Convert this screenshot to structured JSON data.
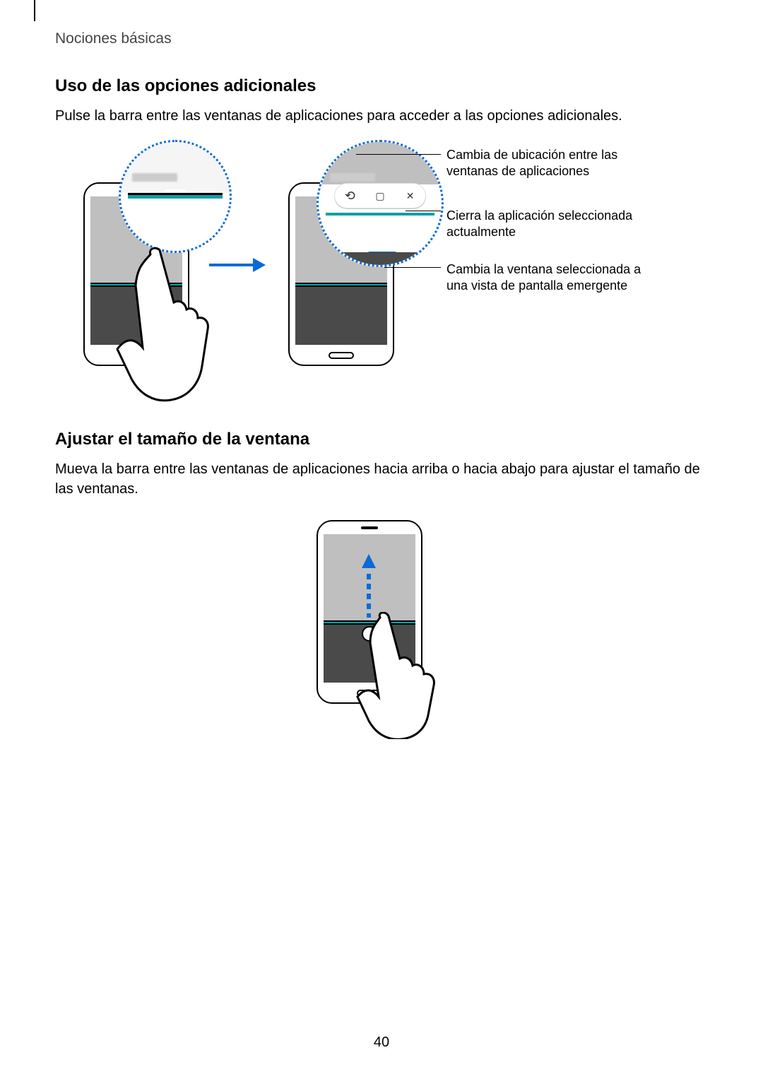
{
  "breadcrumb": "Nociones básicas",
  "section1": {
    "title": "Uso de las opciones adicionales",
    "body": "Pulse la barra entre las ventanas de aplicaciones para acceder a las opciones adicionales."
  },
  "callouts": {
    "swap": "Cambia de ubicación entre las ventanas de aplicaciones",
    "close": "Cierra la aplicación seleccionada actualmente",
    "popup": "Cambia la ventana seleccionada a una vista de pantalla emergente"
  },
  "section2": {
    "title": "Ajustar el tamaño de la ventana",
    "body": "Mueva la barra entre las ventanas de aplicaciones hacia arriba o hacia abajo para ajustar el tamaño de las ventanas."
  },
  "page_number": "40"
}
